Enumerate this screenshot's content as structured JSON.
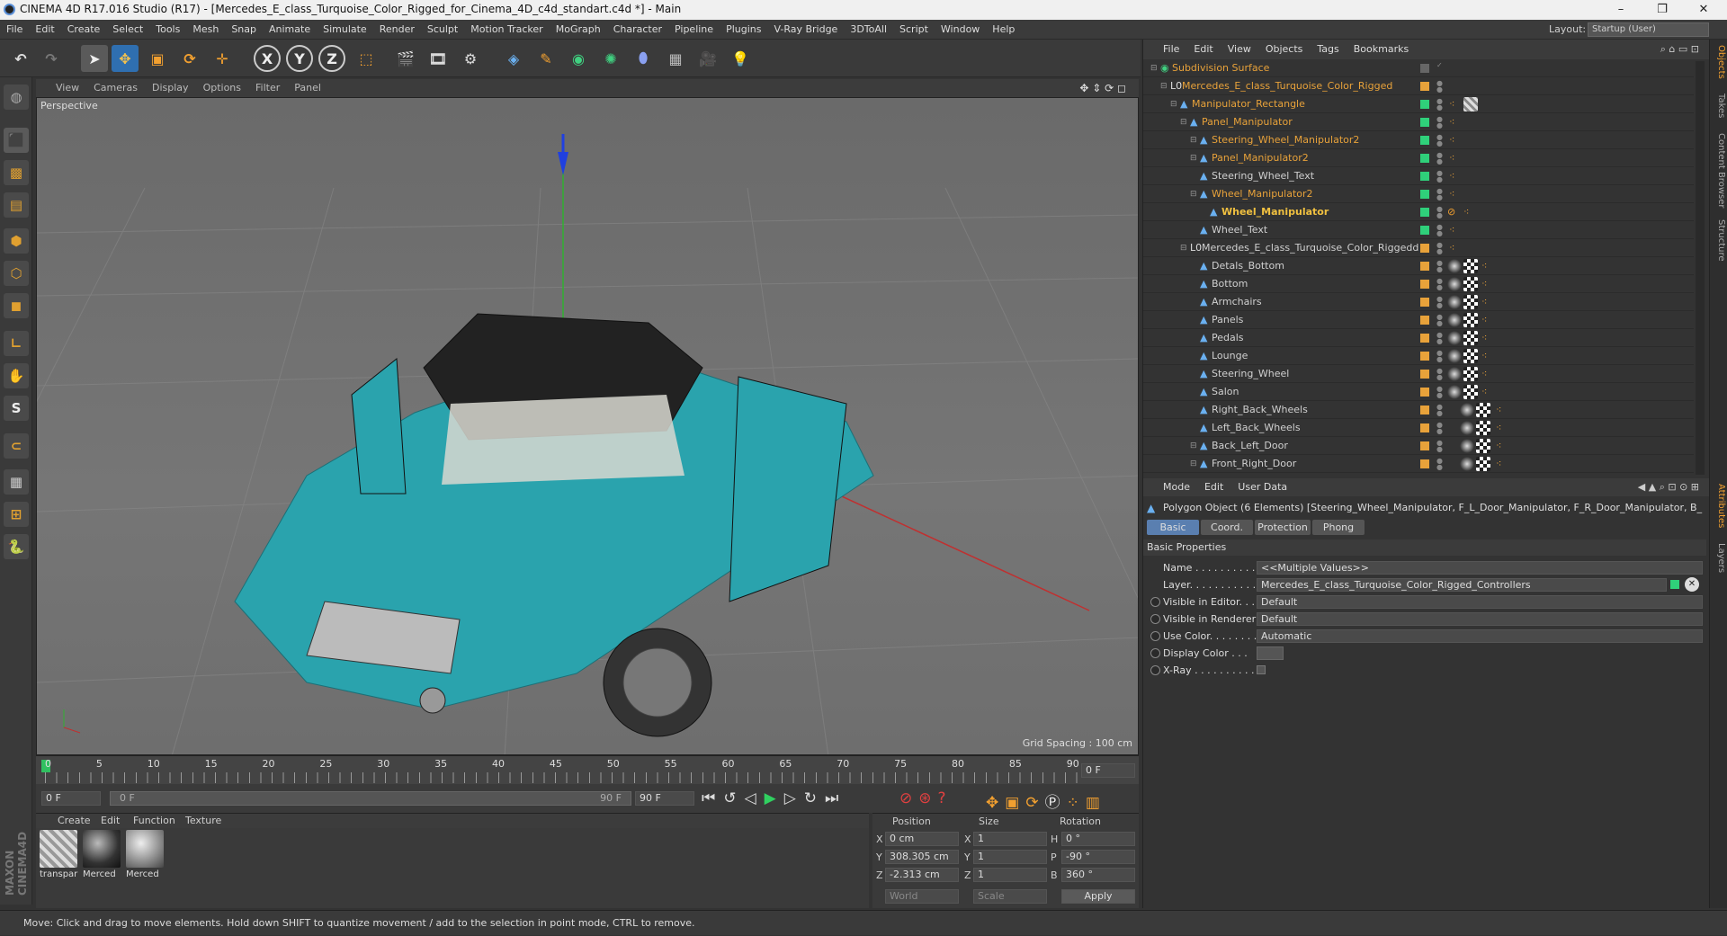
{
  "window": {
    "title": "CINEMA 4D R17.016 Studio (R17) - [Mercedes_E_class_Turquoise_Color_Rigged_for_Cinema_4D_c4d_standart.c4d *] - Main",
    "minimize": "–",
    "restore": "❐",
    "close": "✕"
  },
  "menubar": {
    "items": [
      "File",
      "Edit",
      "Create",
      "Select",
      "Tools",
      "Mesh",
      "Snap",
      "Animate",
      "Simulate",
      "Render",
      "Sculpt",
      "Motion Tracker",
      "MoGraph",
      "Character",
      "Pipeline",
      "Plugins",
      "V-Ray Bridge",
      "3DToAll",
      "Script",
      "Window",
      "Help"
    ],
    "layout_label": "Layout:",
    "layout_value": "Startup (User)"
  },
  "toolbar": {
    "axis_x": "X",
    "axis_y": "Y",
    "axis_z": "Z"
  },
  "viewport": {
    "menu": [
      "View",
      "Cameras",
      "Display",
      "Options",
      "Filter",
      "Panel"
    ],
    "label": "Perspective",
    "grid_spacing": "Grid Spacing : 100 cm"
  },
  "timeline": {
    "ticks": [
      "0",
      "5",
      "10",
      "15",
      "20",
      "25",
      "30",
      "35",
      "40",
      "45",
      "50",
      "55",
      "60",
      "65",
      "70",
      "75",
      "80",
      "85",
      "90"
    ],
    "current_frame": "0 F"
  },
  "timectrl": {
    "start": "0 F",
    "range_start": "0 F",
    "range_end": "90 F",
    "end": "90 F"
  },
  "materials": {
    "menu": [
      "Create",
      "Edit",
      "Function",
      "Texture"
    ],
    "items": [
      "transpar",
      "Merced",
      "Merced"
    ]
  },
  "coords": {
    "headers": {
      "position": "Position",
      "size": "Size",
      "rotation": "Rotation"
    },
    "axes": [
      "X",
      "Y",
      "Z"
    ],
    "rot_axes": [
      "H",
      "P",
      "B"
    ],
    "position": [
      "0 cm",
      "308.305 cm",
      "-2.313 cm"
    ],
    "size": [
      "1",
      "1",
      "1"
    ],
    "rotation": [
      "0 °",
      "-90 °",
      "360 °"
    ],
    "mode": "World",
    "scale": "Scale",
    "apply": "Apply"
  },
  "objects": {
    "menu": [
      "File",
      "Edit",
      "View",
      "Objects",
      "Tags",
      "Bookmarks"
    ],
    "rows": [
      {
        "name": "Subdivision Surface",
        "indent": 0
      },
      {
        "name": "Mercedes_E_class_Turquoise_Color_Rigged",
        "indent": 1
      },
      {
        "name": "Manipulator_Rectangle",
        "indent": 2
      },
      {
        "name": "Panel_Manipulator",
        "indent": 3
      },
      {
        "name": "Steering_Wheel_Manipulator2",
        "indent": 4
      },
      {
        "name": "Panel_Manipulator2",
        "indent": 4
      },
      {
        "name": "Steering_Wheel_Text",
        "indent": 4
      },
      {
        "name": "Wheel_Manipulator2",
        "indent": 4
      },
      {
        "name": "Wheel_Manipulator",
        "indent": 5
      },
      {
        "name": "Wheel_Text",
        "indent": 4
      },
      {
        "name": "Mercedes_E_class_Turquoise_Color_Riggedd",
        "indent": 3
      },
      {
        "name": "Detals_Bottom",
        "indent": 4
      },
      {
        "name": "Bottom",
        "indent": 4
      },
      {
        "name": "Armchairs",
        "indent": 4
      },
      {
        "name": "Panels",
        "indent": 4
      },
      {
        "name": "Pedals",
        "indent": 4
      },
      {
        "name": "Lounge",
        "indent": 4
      },
      {
        "name": "Steering_Wheel",
        "indent": 4
      },
      {
        "name": "Salon",
        "indent": 4
      },
      {
        "name": "Right_Back_Wheels",
        "indent": 4
      },
      {
        "name": "Left_Back_Wheels",
        "indent": 4
      },
      {
        "name": "Back_Left_Door",
        "indent": 4
      },
      {
        "name": "Front_Right_Door",
        "indent": 4
      }
    ]
  },
  "attributes": {
    "menu": [
      "Mode",
      "Edit",
      "User Data"
    ],
    "header": "Polygon Object (6 Elements) [Steering_Wheel_Manipulator, F_L_Door_Manipulator, F_R_Door_Manipulator, B_L_Door",
    "tabs": [
      "Basic",
      "Coord.",
      "Protection",
      "Phong"
    ],
    "section": "Basic Properties",
    "props": [
      {
        "label": "Name . . . . . . . . . . . .",
        "value": "<<Multiple Values>>"
      },
      {
        "label": "Layer. . . . . . . . . . . . .",
        "value": "Mercedes_E_class_Turquoise_Color_Rigged_Controllers"
      },
      {
        "label": "Visible in Editor. . .",
        "value": "Default"
      },
      {
        "label": "Visible in Renderer",
        "value": "Default"
      },
      {
        "label": "Use Color. . . . . . . .",
        "value": "Automatic"
      },
      {
        "label": "Display Color . . .",
        "value": ""
      },
      {
        "label": "X-Ray . . . . . . . . . .",
        "value": ""
      }
    ]
  },
  "rightstrip": [
    "Objects",
    "Takes",
    "Content Browser",
    "Structure",
    "Attributes",
    "Layers"
  ],
  "status": "Move: Click and drag to move elements. Hold down SHIFT to quantize movement / add to the selection in point mode, CTRL to remove.",
  "colors": {
    "orange": "#e8a23a",
    "green": "#2fd07a",
    "selected": "#f0c040",
    "turquoise": "#2aa3ad"
  }
}
